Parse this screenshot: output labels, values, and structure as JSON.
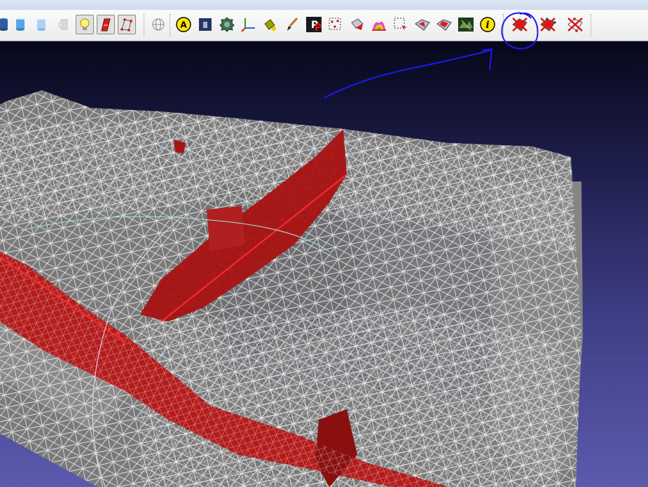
{
  "window": {
    "title_strip": ""
  },
  "toolbar": {
    "buttons": [
      {
        "icon": "cylinder-dark-icon"
      },
      {
        "icon": "cylinder-blue-icon"
      },
      {
        "icon": "cylinder-light-icon"
      },
      {
        "icon": "faded-tool-icon"
      },
      {
        "icon": "light-bulb-icon",
        "pressed": true
      },
      {
        "icon": "red-brush-icon",
        "pressed": true
      },
      {
        "icon": "mesh-points-icon"
      },
      {
        "icon": "globe-grid-icon"
      },
      {
        "icon": "annotation-a-icon",
        "label": "A"
      },
      {
        "icon": "dark-square-icon"
      },
      {
        "icon": "green-gear-icon"
      },
      {
        "icon": "axes-icon"
      },
      {
        "icon": "paint-bucket-icon"
      },
      {
        "icon": "paint-brush-icon"
      },
      {
        "icon": "pp-icon",
        "label": "P"
      },
      {
        "icon": "select-vertices-icon"
      },
      {
        "icon": "select-faces-icon"
      },
      {
        "icon": "color-rainbow-icon"
      },
      {
        "icon": "select-rect-icon"
      },
      {
        "icon": "select-connected-icon"
      },
      {
        "icon": "select-region-icon"
      },
      {
        "icon": "raster-image-icon"
      },
      {
        "icon": "info-icon",
        "label": "i"
      },
      {
        "icon": "delete-faces-icon"
      },
      {
        "icon": "delete-faces-vertices-icon"
      },
      {
        "icon": "delete-vertices-icon"
      }
    ]
  },
  "colors": {
    "annotation_blue": "#1a1ae6",
    "mesh_red": "#c81515",
    "mesh_gray": "#767676",
    "wire_white": "#ffffff"
  }
}
